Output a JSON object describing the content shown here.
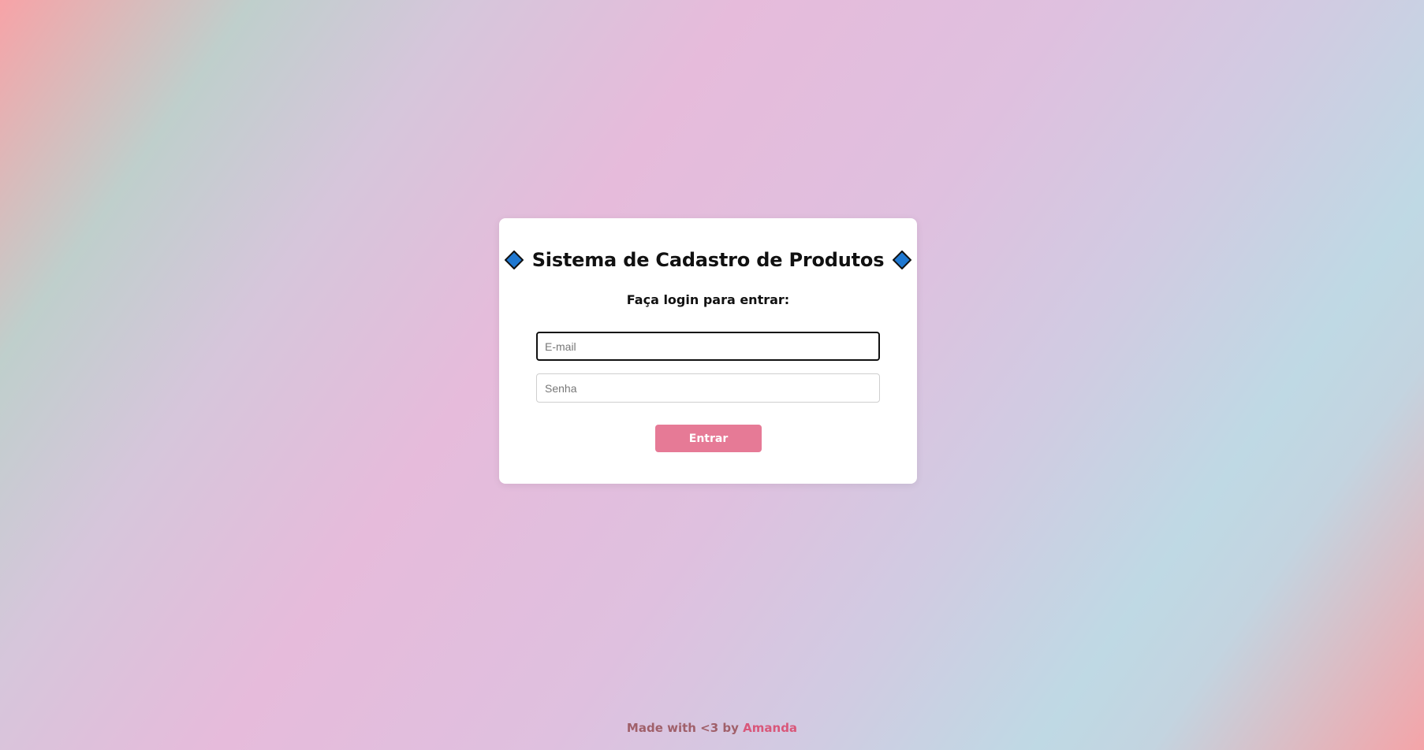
{
  "login": {
    "title": "Sistema de Cadastro de Produtos",
    "subtitle": "Faça login para entrar:",
    "email_placeholder": "E-mail",
    "email_value": "",
    "password_placeholder": "Senha",
    "password_value": "",
    "submit_label": "Entrar",
    "title_icon": "blue-diamond-icon"
  },
  "footer": {
    "text": "Made with <3 by",
    "author": "Amanda"
  },
  "colors": {
    "button": "#e67a96",
    "diamond": "#1f78d1",
    "footer_text": "#a0606a",
    "footer_author": "#d9577a"
  }
}
